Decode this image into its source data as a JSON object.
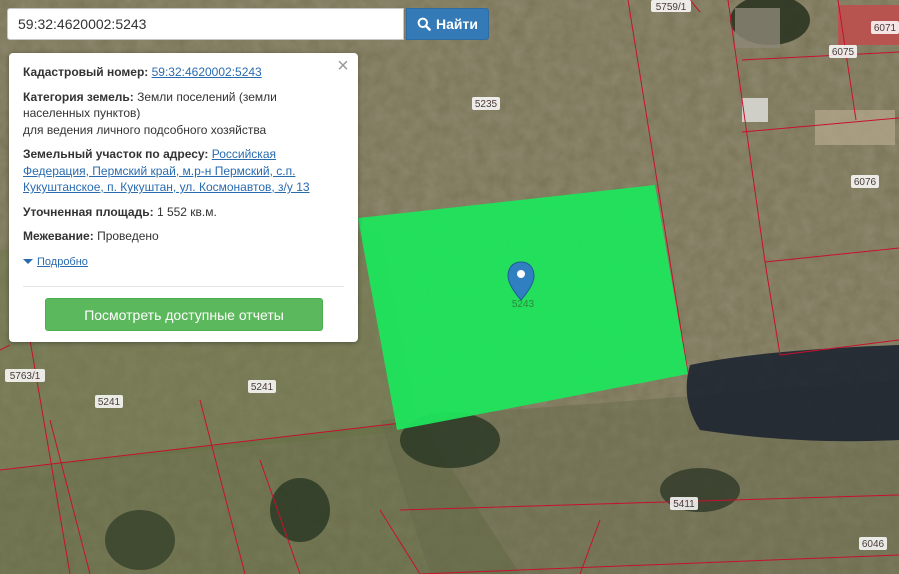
{
  "search": {
    "value": "59:32:4620002:5243",
    "button_label": "Найти"
  },
  "popup": {
    "cadastral": {
      "key": "Кадастровый номер:",
      "value": "59:32:4620002:5243"
    },
    "category": {
      "key": "Категория земель:",
      "value_line1": "Земли поселений (земли",
      "value_line2": "населенных пунктов)",
      "value_line3": "для ведения личного подсобного хозяйства"
    },
    "address": {
      "key": "Земельный участок по адресу:",
      "value_line1": "Российская",
      "value_line2": "Федерация, Пермский край, м.р-н Пермский, с.п.",
      "value_line3": "Кукуштанское, п. Кукуштан, ул. Космонавтов, з/у 13"
    },
    "area": {
      "key": "Уточненная площадь:",
      "value": "1 552 кв.м."
    },
    "survey": {
      "key": "Межевание:",
      "value": "Проведено"
    },
    "more_label": "Подробно",
    "reports_button": "Посмотреть доступные отчеты",
    "close_symbol": "×"
  },
  "map": {
    "selected_parcel_label": "5243",
    "highlight_color": "#1ee55c",
    "boundary_color": "#c8102e",
    "marker_color": "#2f7fc1",
    "parcel_labels": [
      "5235",
      "5759/1",
      "6075",
      "6071",
      "6076",
      "5763/1",
      "5241",
      "5241",
      "5411",
      "6046"
    ]
  }
}
